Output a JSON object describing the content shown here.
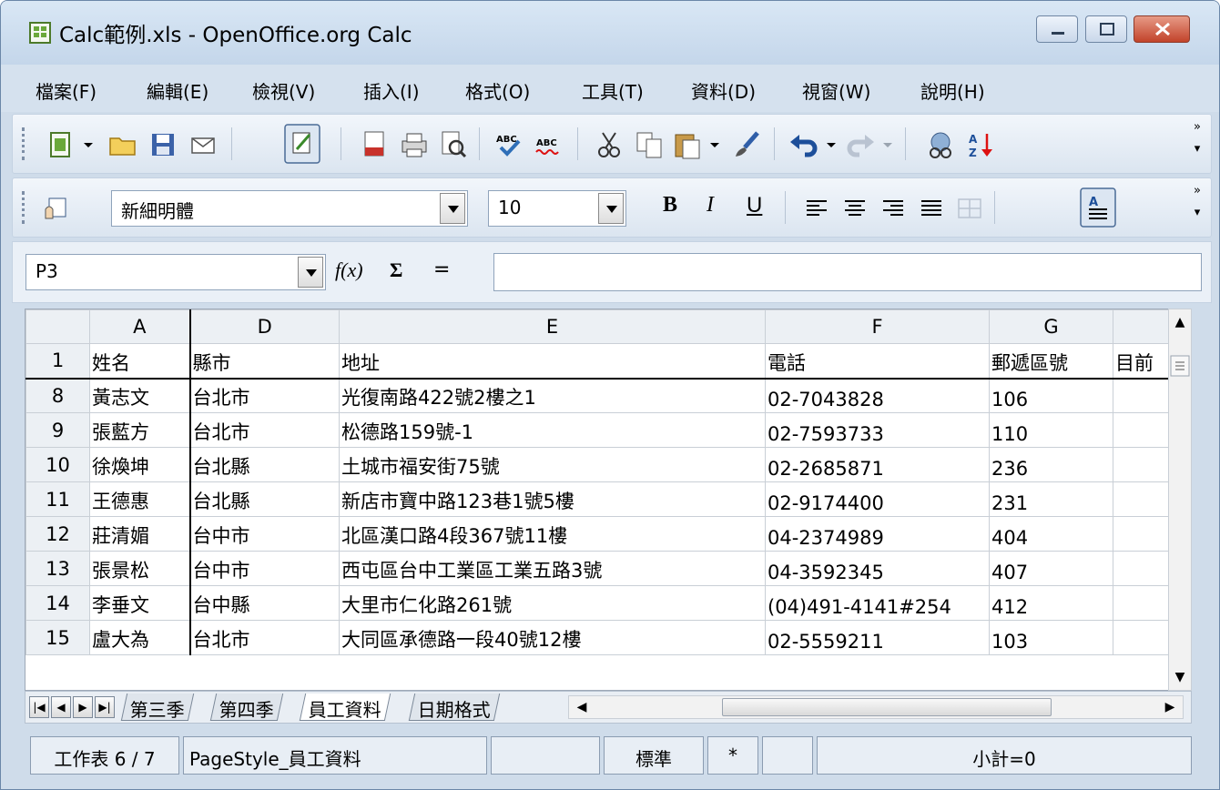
{
  "window": {
    "title": "Calc範例.xls - OpenOffice.org Calc"
  },
  "menu": [
    "檔案(F)",
    "編輯(E)",
    "檢視(V)",
    "插入(I)",
    "格式(O)",
    "工具(T)",
    "資料(D)",
    "視窗(W)",
    "說明(H)"
  ],
  "format_toolbar": {
    "font_name": "新細明體",
    "font_size": "10",
    "bold": "B",
    "italic": "I",
    "underline": "U"
  },
  "formula_bar": {
    "cell_ref": "P3",
    "fx_label": "f(x)",
    "sum_label": "Σ",
    "equals_label": "=",
    "value": ""
  },
  "grid": {
    "columns": [
      "A",
      "D",
      "E",
      "F",
      "G",
      ""
    ],
    "header_row": {
      "row": "1",
      "cells": [
        "姓名",
        "縣市",
        "地址",
        "電話",
        "郵遞區號",
        "目前"
      ]
    },
    "rows": [
      {
        "row": "8",
        "cells": [
          "黃志文",
          "台北市",
          "光復南路422號2樓之1",
          "02-7043828",
          "106",
          ""
        ]
      },
      {
        "row": "9",
        "cells": [
          "張藍方",
          "台北市",
          "松德路159號-1",
          "02-7593733",
          "110",
          ""
        ]
      },
      {
        "row": "10",
        "cells": [
          "徐煥坤",
          "台北縣",
          "土城市福安街75號",
          "02-2685871",
          "236",
          ""
        ]
      },
      {
        "row": "11",
        "cells": [
          "王德惠",
          "台北縣",
          "新店市寶中路123巷1號5樓",
          "02-9174400",
          "231",
          ""
        ]
      },
      {
        "row": "12",
        "cells": [
          "莊清媚",
          "台中市",
          "北區漢口路4段367號11樓",
          "04-2374989",
          "404",
          ""
        ]
      },
      {
        "row": "13",
        "cells": [
          "張景松",
          "台中市",
          "西屯區台中工業區工業五路3號",
          "04-3592345",
          "407",
          ""
        ]
      },
      {
        "row": "14",
        "cells": [
          "李垂文",
          "台中縣",
          "大里市仁化路261號",
          "(04)491-4141#254",
          "412",
          ""
        ]
      },
      {
        "row": "15",
        "cells": [
          "盧大為",
          "台北市",
          "大同區承德路一段40號12樓",
          "02-5559211",
          "103",
          ""
        ]
      }
    ]
  },
  "sheet_tabs": [
    "第三季",
    "第四季",
    "員工資料",
    "日期格式"
  ],
  "active_tab": "員工資料",
  "statusbar": {
    "sheet": "工作表 6 / 7",
    "page_style": "PageStyle_員工資料",
    "mode": "標準",
    "modified": "*",
    "sum": "小計=0"
  }
}
